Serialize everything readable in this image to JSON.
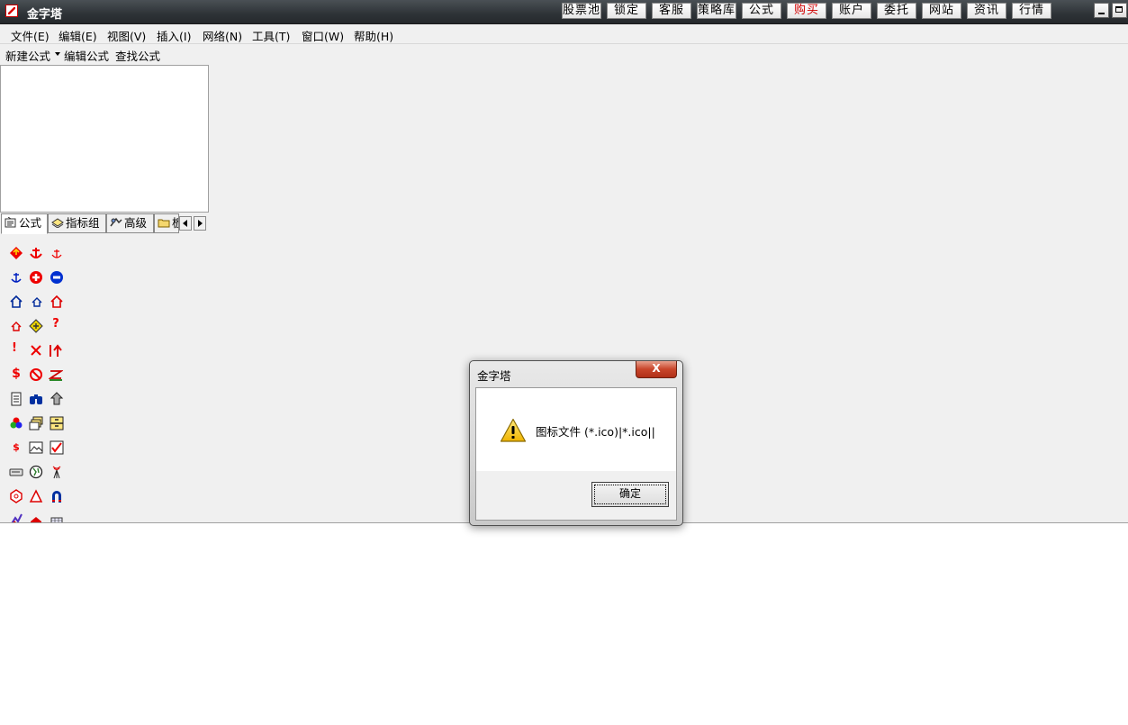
{
  "window": {
    "title": "金字塔",
    "toolbar_buttons": [
      {
        "label": "股票池",
        "color": "#000000"
      },
      {
        "label": "锁定",
        "color": "#000000"
      },
      {
        "label": "客服",
        "color": "#000000"
      },
      {
        "label": "策略库",
        "color": "#000000"
      },
      {
        "label": "公式",
        "color": "#000000"
      },
      {
        "label": "购买",
        "color": "#d00000"
      },
      {
        "label": "账户",
        "color": "#000000"
      },
      {
        "label": "委托",
        "color": "#000000"
      },
      {
        "label": "网站",
        "color": "#000000"
      },
      {
        "label": "资讯",
        "color": "#000000"
      },
      {
        "label": "行情",
        "color": "#000000"
      }
    ]
  },
  "menubar": {
    "items": [
      "文件(E)",
      "编辑(E)",
      "视图(V)",
      "插入(I)",
      "网络(N)",
      "工具(T)",
      "窗口(W)",
      "帮助(H)"
    ]
  },
  "formula_toolbar": {
    "new_formula": "新建公式",
    "edit_formula": "编辑公式",
    "find_formula": "查找公式"
  },
  "tabs": [
    {
      "label": "公式",
      "icon": "formula-icon",
      "active": true
    },
    {
      "label": "指标组",
      "icon": "indicator-group-icon",
      "active": false
    },
    {
      "label": "高级",
      "icon": "advanced-icon",
      "active": false
    },
    {
      "label": "板",
      "icon": "folder-icon",
      "active": false
    }
  ],
  "icon_grid": [
    [
      "diamond-up-icon",
      "anchor-red-icon",
      "anchor-small-red-icon"
    ],
    [
      "anchor-blue-icon",
      "red-cross-icon",
      "no-entry-icon"
    ],
    [
      "house-blue-icon",
      "house-small-blue-icon",
      "house-red-icon"
    ],
    [
      "house-small-red-icon",
      "diamond-yellow-icon",
      "question-red-icon"
    ],
    [
      "exclamation-red-icon",
      "x-red-icon",
      "bar-arrow-up-icon"
    ],
    [
      "dollar-red-icon",
      "prohibited-icon",
      "z-sign-icon"
    ],
    [
      "document-icon",
      "binoculars-icon",
      "arrow-house-icon"
    ],
    [
      "color-circles-icon",
      "windows-stack-icon",
      "cabinet-icon"
    ],
    [
      "small-dollar-icon",
      "picture-icon",
      "check-doc-icon"
    ],
    [
      "battery-icon",
      "globe-icon",
      "antenna-icon"
    ],
    [
      "hexagon-icon",
      "triangle-icon",
      "magnet-icon"
    ],
    [
      "star-blue-icon",
      "house-flag-icon",
      "grid-small-icon"
    ]
  ],
  "dialog": {
    "title": "金字塔",
    "close_label": "X",
    "message": "图标文件 (*.ico)|*.ico||",
    "ok_label": "确定"
  }
}
